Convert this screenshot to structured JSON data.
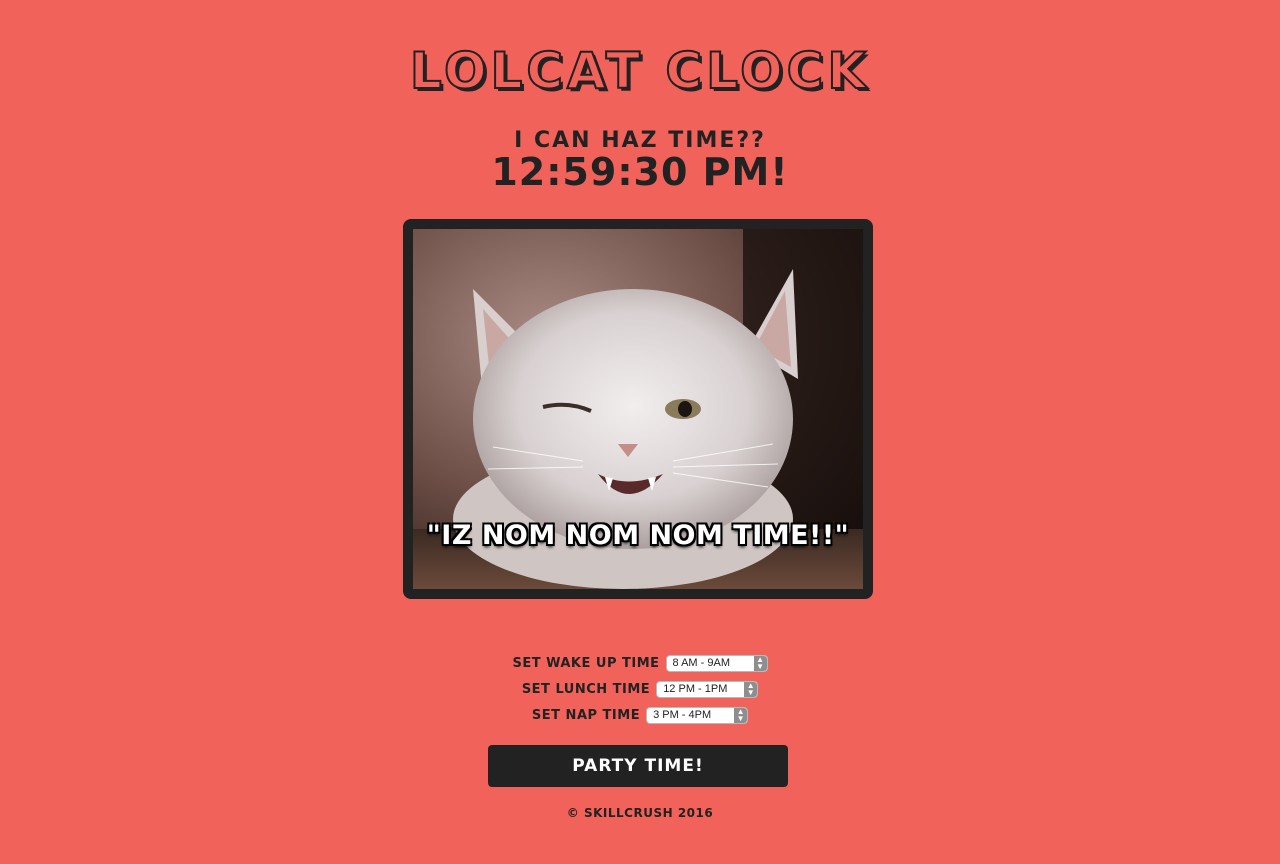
{
  "header": {
    "title": "Lolcat Clock",
    "question": "I can haz time??",
    "clock": "12:59:30 PM!"
  },
  "image": {
    "caption": "\"IZ NOM NOM NOM TIME!!\""
  },
  "settings": {
    "wake": {
      "label": "Set Wake Up Time",
      "value": "8 AM - 9AM"
    },
    "lunch": {
      "label": "Set Lunch Time",
      "value": "12 PM - 1PM"
    },
    "nap": {
      "label": "Set Nap Time",
      "value": "3 PM - 4PM"
    }
  },
  "party_button": {
    "label": "Party Time!"
  },
  "footer": {
    "text": "© SkillCrush 2016"
  },
  "colors": {
    "background": "#f1625b",
    "text": "#222222",
    "button": "#222222"
  }
}
